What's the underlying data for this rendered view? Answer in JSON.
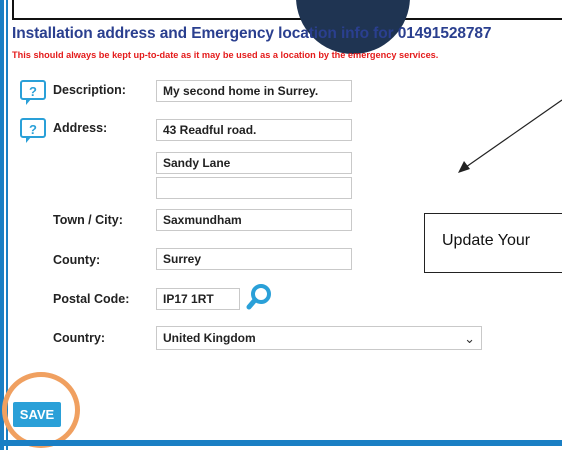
{
  "header": {
    "title": "Installation address and Emergency location info for 01491528787",
    "warning": "This should always be kept up-to-date as it may be used as a location by the emergency services."
  },
  "badge": {
    "text": ""
  },
  "form": {
    "help_icon_glyph": "?",
    "description": {
      "label": "Description:",
      "value": "My second home in Surrey."
    },
    "address": {
      "label": "Address:",
      "line1": "43 Readful road.",
      "line2": "Sandy Lane",
      "line3": ""
    },
    "town": {
      "label": "Town / City:",
      "value": "Saxmundham"
    },
    "county": {
      "label": "County:",
      "value": "Surrey"
    },
    "postal": {
      "label": "Postal Code:",
      "value": "IP17 1RT"
    },
    "country": {
      "label": "Country:",
      "value": "United Kingdom",
      "chevron": "⌄"
    }
  },
  "callout": {
    "text": "Update Your"
  },
  "save_button": {
    "label": "SAVE"
  },
  "icons": {
    "help": "help-icon",
    "lookup": "search-icon",
    "dropdown": "chevron-down-icon"
  },
  "colors": {
    "title": "#2a3f8f",
    "warning": "#e41b1b",
    "accent": "#2aa0d8",
    "border": "#1a7fc4",
    "highlight_ring": "#f0a060"
  }
}
